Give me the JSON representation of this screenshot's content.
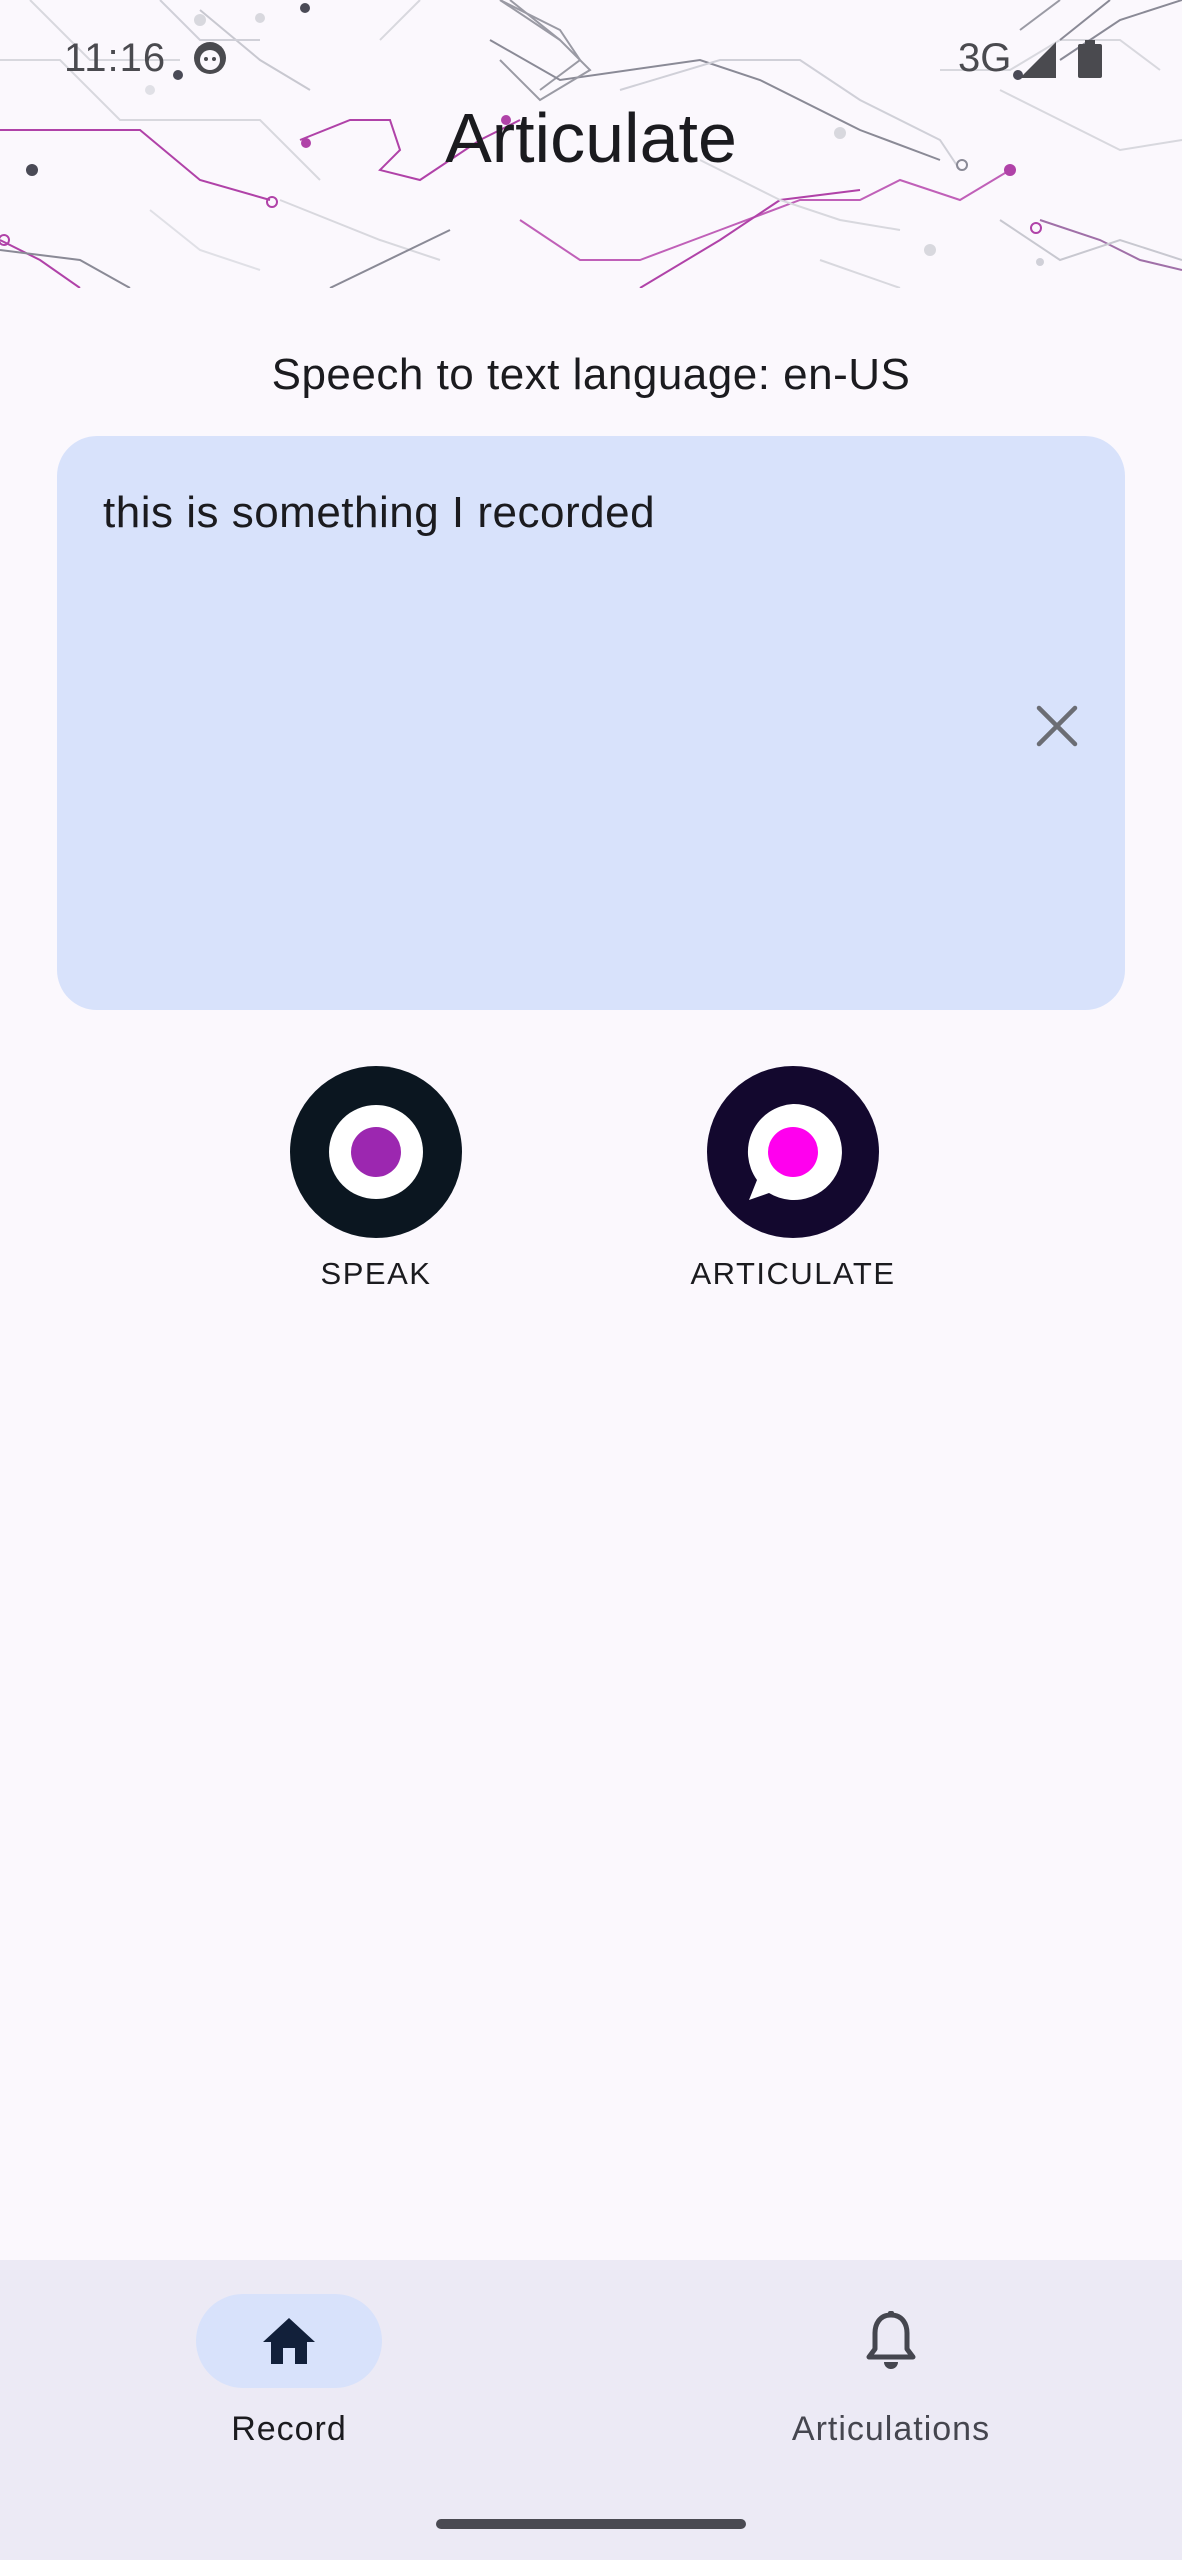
{
  "status_bar": {
    "time": "11:16",
    "network": "3G",
    "icons": [
      "face-notification-icon",
      "signal-icon",
      "battery-icon"
    ]
  },
  "app": {
    "title": "Articulate"
  },
  "language": {
    "label": "Speech to text language: en-US"
  },
  "transcript": {
    "text": "this is something I recorded",
    "clear_icon": "close-icon"
  },
  "actions": {
    "speak_label": "SPEAK",
    "articulate_label": "ARTICULATE"
  },
  "bottom_nav": {
    "items": [
      {
        "label": "Record",
        "icon": "home-icon",
        "selected": true
      },
      {
        "label": "Articulations",
        "icon": "bell-icon",
        "selected": false
      }
    ]
  },
  "colors": {
    "background": "#fbf8fd",
    "card": "#d8e2fb",
    "speak_outer": "#0b1620",
    "speak_dot": "#9c27b0",
    "articulate_outer": "#13082e",
    "articulate_dot": "#ff00ee",
    "nav_background": "#eceaf5",
    "nav_selected": "#d8e2fb"
  }
}
